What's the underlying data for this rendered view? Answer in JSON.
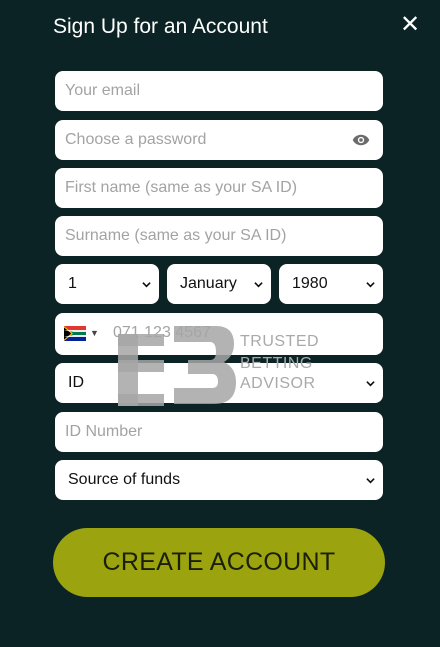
{
  "header": {
    "title": "Sign Up for an Account",
    "close_icon": "close-icon"
  },
  "form": {
    "email": {
      "placeholder": "Your email"
    },
    "password": {
      "placeholder": "Choose a password"
    },
    "first_name": {
      "placeholder": "First name (same as your SA ID)"
    },
    "surname": {
      "placeholder": "Surname (same as your SA ID)"
    },
    "dob": {
      "day": "1",
      "month": "January",
      "year": "1980"
    },
    "phone": {
      "placeholder": "071 123 4567",
      "country_flag": "south-africa-flag-icon"
    },
    "id_type": {
      "value": "ID"
    },
    "id_number": {
      "placeholder": "ID Number"
    },
    "source_of_funds": {
      "value": "Source of funds"
    },
    "submit_label": "CREATE ACCOUNT"
  },
  "watermark": {
    "line1": "TRUSTED",
    "line2": "BETTING",
    "line3": "ADVISOR"
  },
  "colors": {
    "background": "#0b2325",
    "button": "#9ba30f",
    "field": "#ffffff"
  }
}
